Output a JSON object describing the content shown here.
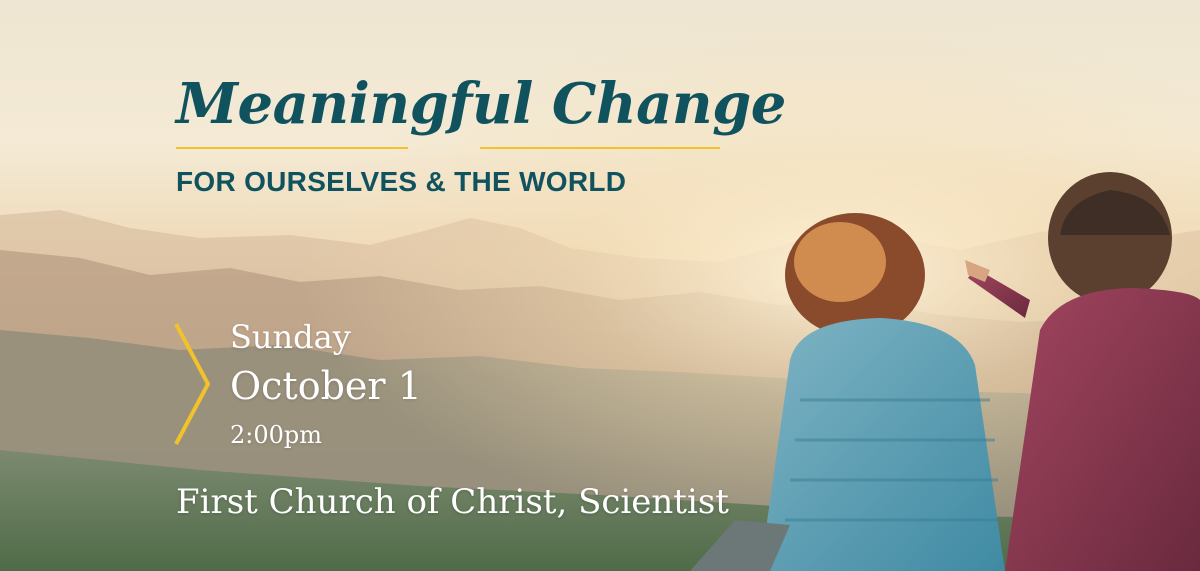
{
  "banner": {
    "title": "Meaningful Change",
    "subtitle": "FOR OURSELVES & THE WORLD",
    "event": {
      "day": "Sunday",
      "date": "October 1",
      "time": "2:00pm",
      "venue": "First Church of Christ, Scientist"
    }
  },
  "colors": {
    "title": "#10535f",
    "accent": "#f2c22c",
    "event_text": "#ffffff"
  },
  "icons": {
    "chevron": "chevron-right-icon"
  }
}
